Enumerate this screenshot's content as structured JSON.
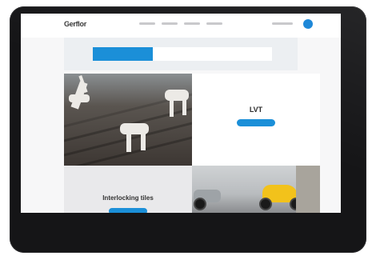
{
  "site": {
    "logo": "Gerflor"
  },
  "nav": {
    "items": [
      "",
      "",
      "",
      ""
    ]
  },
  "header": {
    "signin": "",
    "account_icon": "user-icon"
  },
  "tabs": [
    "",
    "",
    ""
  ],
  "tiles": [
    {
      "title": "LVT",
      "button": ""
    },
    {
      "title": "Interlocking tiles",
      "button": ""
    }
  ],
  "colors": {
    "accent": "#1b8fd8",
    "device": "#151517"
  }
}
